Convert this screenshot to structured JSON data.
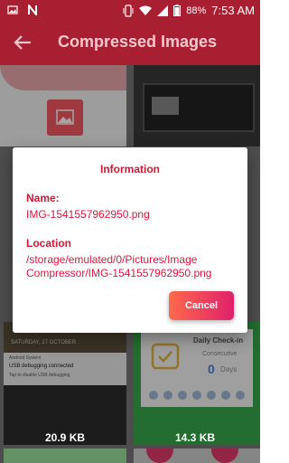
{
  "status_bar": {
    "battery": "88%",
    "time": "7:53 AM"
  },
  "app_bar": {
    "title": "Compressed Images"
  },
  "grid": {
    "items": [
      {
        "size": "20.9 KB"
      },
      {
        "size": "14.3 KB"
      }
    ],
    "background_tiles": {
      "lockscreen_date": "SATURDAY, 27 OCTOBER",
      "notification_app": "Android System",
      "notification_title": "USB debugging connected",
      "notification_text": "Tap to disable USB debugging",
      "checkin_title": "Daily Check-in",
      "checkin_sub": "Consecutive",
      "checkin_count": "0",
      "checkin_unit": "Days"
    }
  },
  "dialog": {
    "title": "Information",
    "name_label": "Name:",
    "name_value": "IMG-1541557962950.png",
    "location_label": "Location",
    "location_value": "/storage/emulated/0/Pictures/Image Compressor/IMG-1541557962950.png",
    "cancel_label": "Cancel"
  },
  "colors": {
    "primary": "#a71f31",
    "accent": "#d41632",
    "button_gradient_start": "#ff6a4d",
    "button_gradient_end": "#e0206a"
  }
}
